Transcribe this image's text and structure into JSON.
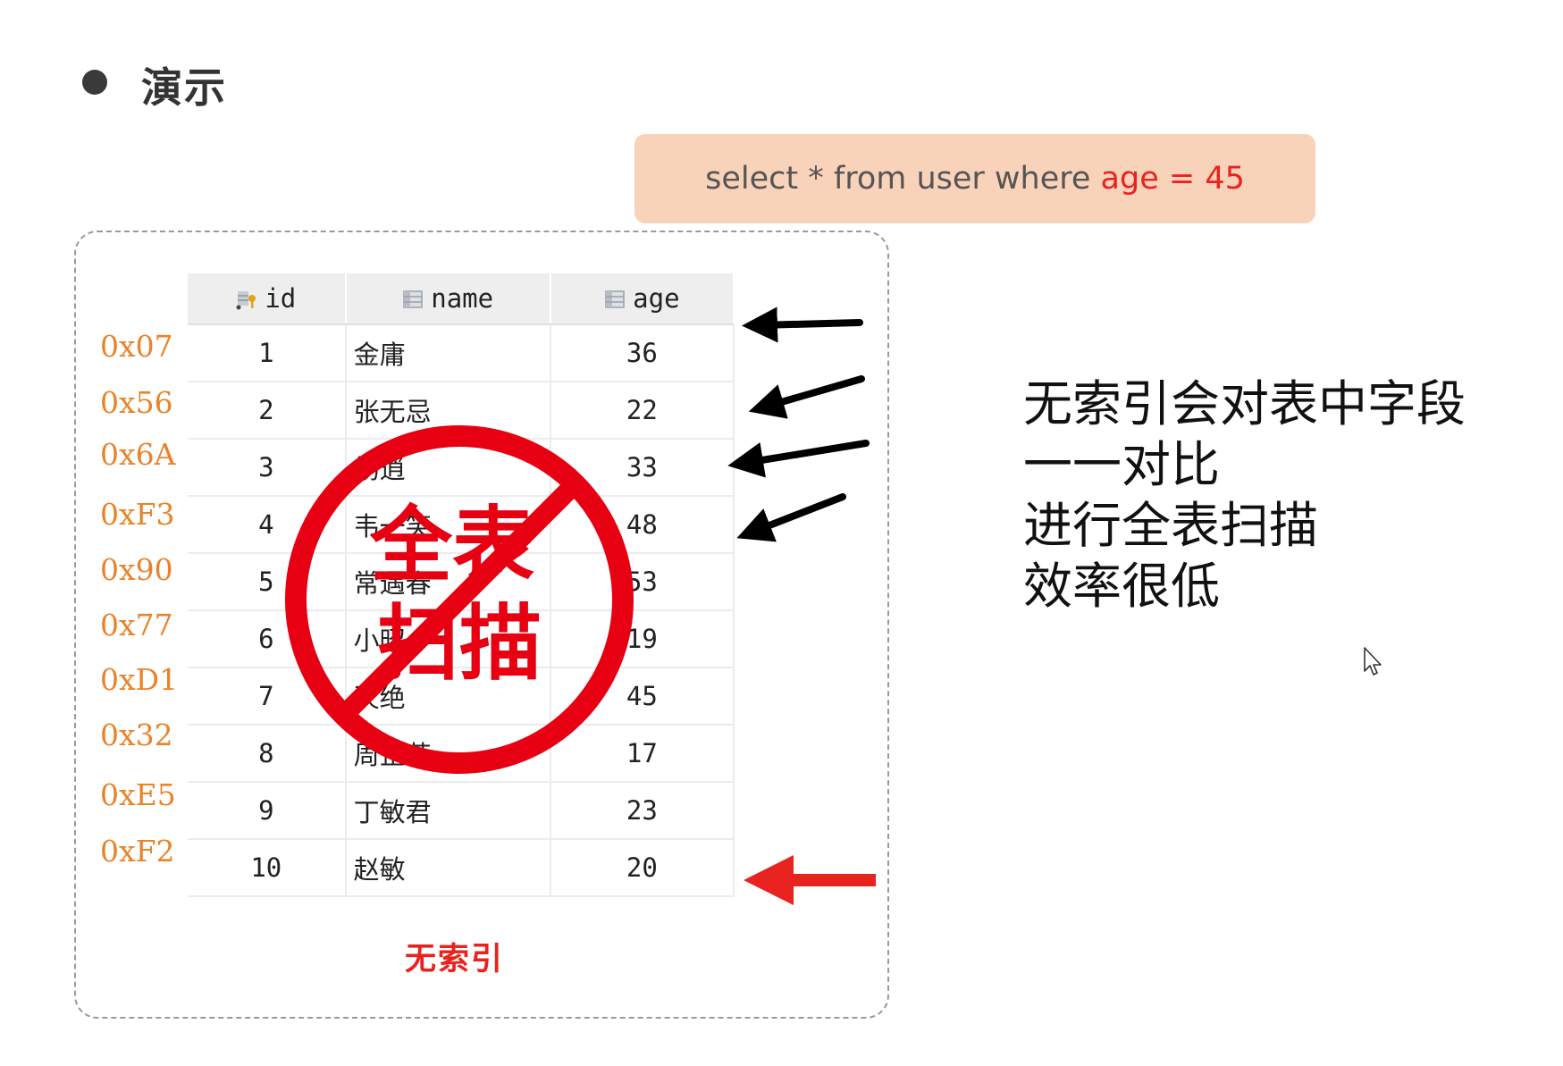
{
  "title": "演示",
  "sql": {
    "prefix": "select * from user where ",
    "highlight": "age = 45"
  },
  "table": {
    "columns": [
      {
        "label": "id",
        "icon": "primary-key-column-icon"
      },
      {
        "label": "name",
        "icon": "column-icon"
      },
      {
        "label": "age",
        "icon": "column-icon"
      }
    ],
    "rows": [
      {
        "addr": "0x07",
        "id": "1",
        "name": "金庸",
        "age": "36"
      },
      {
        "addr": "0x56",
        "id": "2",
        "name": "张无忌",
        "age": "22"
      },
      {
        "addr": "0x6A",
        "id": "3",
        "name": "杨逍",
        "age": "33"
      },
      {
        "addr": "0xF3",
        "id": "4",
        "name": "韦一笑",
        "age": "48"
      },
      {
        "addr": "0x90",
        "id": "5",
        "name": "常遇春",
        "age": "53"
      },
      {
        "addr": "0x77",
        "id": "6",
        "name": "小昭",
        "age": "19"
      },
      {
        "addr": "0xD1",
        "id": "7",
        "name": "灭绝",
        "age": "45"
      },
      {
        "addr": "0x32",
        "id": "8",
        "name": "周芷若",
        "age": "17"
      },
      {
        "addr": "0xE5",
        "id": "9",
        "name": "丁敏君",
        "age": "23"
      },
      {
        "addr": "0xF2",
        "id": "10",
        "name": "赵敏",
        "age": "20"
      }
    ]
  },
  "stamp": {
    "line1": "全表",
    "line2": "扫描"
  },
  "frame_caption": "无索引",
  "explanation": [
    "无索引会对表中字段",
    "一一对比",
    "进行全表扫描",
    "效率很低"
  ],
  "colors": {
    "accent_red": "#e8231f",
    "address_orange": "#e9832a",
    "sql_bg": "#f9d2ba",
    "stamp_red": "#e60012"
  },
  "icons": {
    "bullet": "bullet-dot-icon",
    "arrows": "arrow-left-icon",
    "cursor": "mouse-cursor-icon"
  }
}
